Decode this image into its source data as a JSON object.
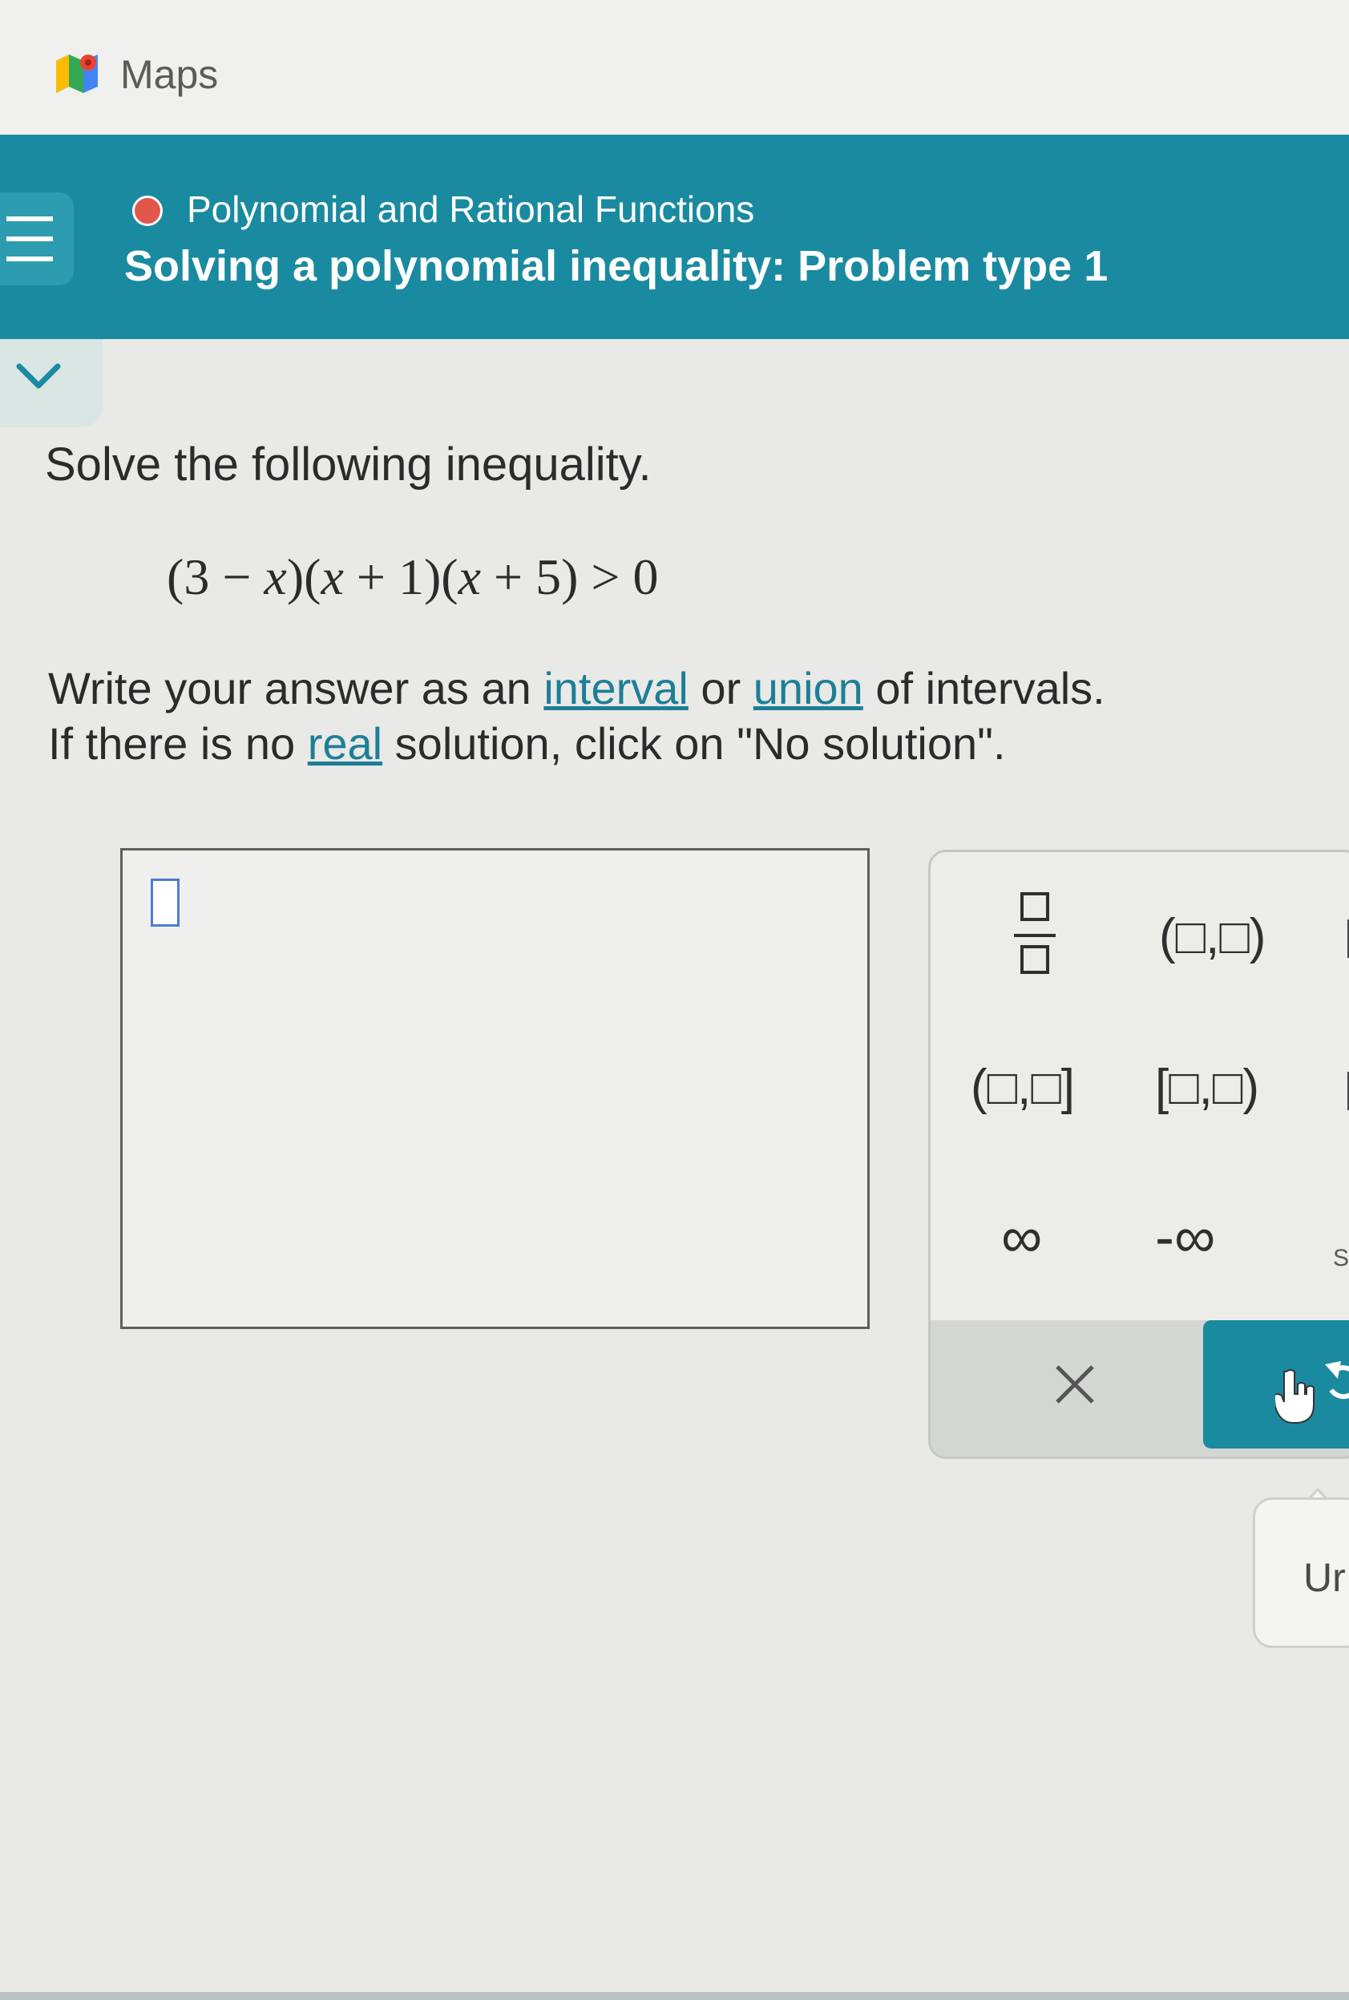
{
  "app": {
    "name": "Maps"
  },
  "header": {
    "topic": "Polynomial and Rational Functions",
    "title": "Solving a polynomial inequality: Problem type 1",
    "accent_color": "#1a8aa0",
    "status_dot_color": "#e2574c"
  },
  "problem": {
    "prompt": "Solve the following inequality.",
    "equation": {
      "open1": "(3 − ",
      "var1": "x",
      "close1": ")",
      "open2": "(",
      "var2": "x",
      "mid2": " + 1)",
      "open3": "(",
      "var3": "x",
      "mid3": " + 5) > 0"
    },
    "instructions": {
      "p1": "Write your answer as an ",
      "link_interval": "interval",
      "p2": " or ",
      "link_union": "union",
      "p3": " of intervals.",
      "p4": "If there is no ",
      "link_real": "real",
      "p5": " solution, click on \"No solution\"."
    }
  },
  "keypad": {
    "open_open": "(□,□)",
    "open_closed": "(□,□]",
    "closed_open": "[□,□)",
    "infinity": "∞",
    "neg_infinity": "-∞",
    "clear": "×",
    "partial_label": "S"
  },
  "tooltip": {
    "text": "Ur"
  },
  "icons": {
    "app": "maps-icon",
    "menu": "hamburger-menu-icon",
    "collapse": "chevron-down-icon",
    "fraction": "fraction-icon",
    "clear": "close-icon",
    "undo": "undo-icon",
    "pointer": "hand-pointer-icon"
  }
}
